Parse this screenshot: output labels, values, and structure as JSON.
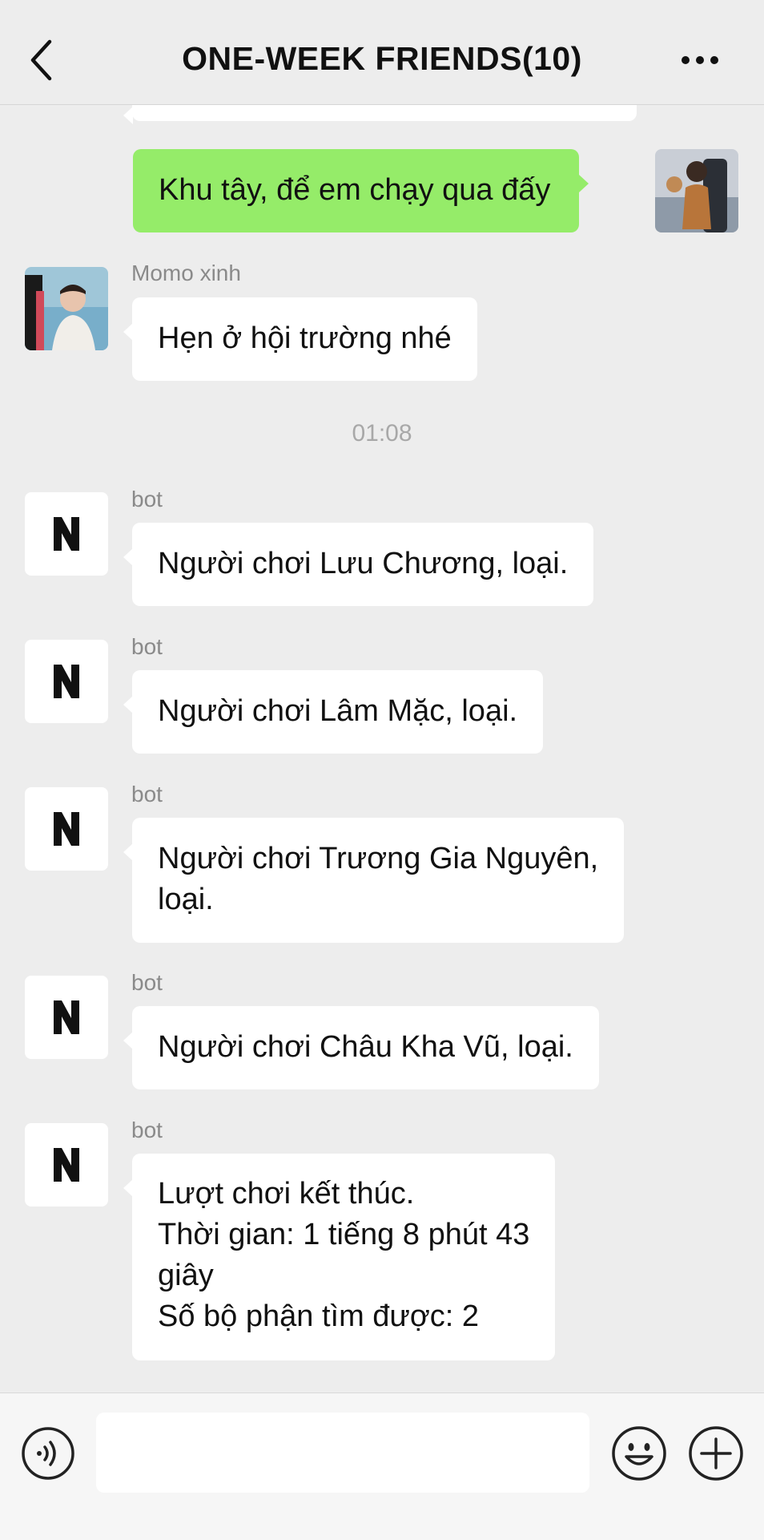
{
  "header": {
    "title": "ONE-WEEK FRIENDS(10)",
    "back_icon": "chevron-left-icon",
    "more_icon": "more-dots-icon"
  },
  "messages": [
    {
      "type": "outgoing",
      "text": "Khu tây, để em chạy qua đấy"
    },
    {
      "type": "incoming",
      "sender": "Momo xinh",
      "text": "Hẹn ở hội trường nhé"
    },
    {
      "type": "time",
      "text": "01:08"
    },
    {
      "type": "incoming",
      "sender": "bot",
      "text": "Người chơi Lưu Chương, loại."
    },
    {
      "type": "incoming",
      "sender": "bot",
      "text": "Người chơi Lâm Mặc, loại."
    },
    {
      "type": "incoming",
      "sender": "bot",
      "lines": [
        "Người chơi Trương Gia Nguyên,",
        "loại."
      ]
    },
    {
      "type": "incoming",
      "sender": "bot",
      "text": "Người chơi Châu Kha Vũ, loại."
    },
    {
      "type": "incoming",
      "sender": "bot",
      "lines": [
        "Lượt chơi kết thúc.",
        "Thời gian: 1 tiếng 8 phút 43",
        "giây",
        "Số bộ phận tìm được: 2"
      ]
    }
  ],
  "footer": {
    "voice_icon": "voice-icon",
    "emoji_icon": "emoji-icon",
    "plus_icon": "plus-icon",
    "input_value": ""
  },
  "colors": {
    "background": "#ededed",
    "outgoing_bubble": "#95ec69",
    "incoming_bubble": "#ffffff",
    "meta_text": "#8a8a8a"
  }
}
